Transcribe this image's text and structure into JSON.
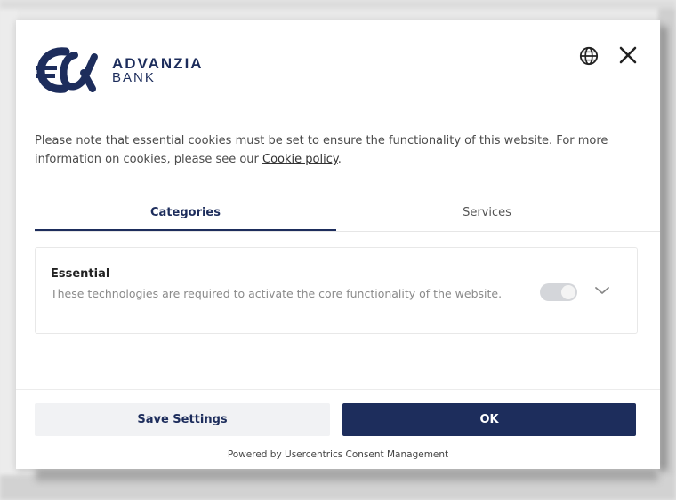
{
  "brand": {
    "name": "ADVANZIA",
    "sub": "BANK",
    "color": "#1d2d5c"
  },
  "header": {
    "language_icon": "globe-icon",
    "close_icon": "close-icon"
  },
  "notice": {
    "text": "Please note that essential cookies must be set to ensure the functionality of this website. For more information on cookies, please see our ",
    "link_label": "Cookie policy",
    "suffix": "."
  },
  "tabs": [
    {
      "label": "Categories",
      "active": true
    },
    {
      "label": "Services",
      "active": false
    }
  ],
  "categories": [
    {
      "title": "Essential",
      "description": "These technologies are required to activate the core functionality of the website.",
      "enabled": true,
      "disabled_toggle": true,
      "expand_icon": "chevron-down-icon"
    }
  ],
  "footer": {
    "save_label": "Save Settings",
    "ok_label": "OK",
    "powered_by": "Powered by Usercentrics Consent Management"
  },
  "colors": {
    "primary": "#1d2d5c",
    "secondary_button_bg": "#f1f2f4",
    "toggle_disabled": "#d4d6da"
  }
}
